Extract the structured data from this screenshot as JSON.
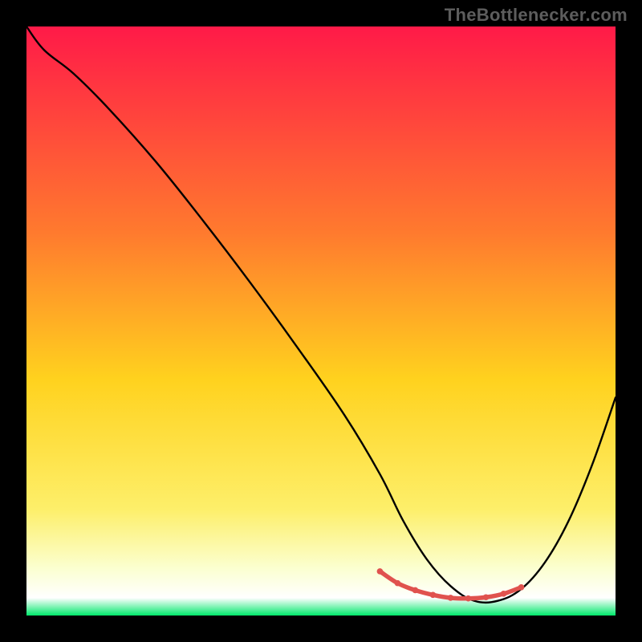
{
  "watermark": "TheBottlenecker.com",
  "chart_data": {
    "type": "line",
    "title": "",
    "xlabel": "",
    "ylabel": "",
    "xlim": [
      0,
      100
    ],
    "ylim": [
      0,
      100
    ],
    "gradient_stops": [
      {
        "offset": 0,
        "color": "#ff1a48"
      },
      {
        "offset": 0.35,
        "color": "#ff7a2e"
      },
      {
        "offset": 0.6,
        "color": "#ffd21e"
      },
      {
        "offset": 0.82,
        "color": "#fdef6a"
      },
      {
        "offset": 0.92,
        "color": "#fbffd0"
      },
      {
        "offset": 0.97,
        "color": "#ffffff"
      },
      {
        "offset": 1.0,
        "color": "#00e86b"
      }
    ],
    "curve": {
      "x": [
        0,
        3,
        8,
        14,
        22,
        30,
        38,
        46,
        54,
        60,
        64,
        68,
        72,
        76,
        80,
        84,
        88,
        92,
        96,
        100
      ],
      "y": [
        100,
        96,
        92,
        86,
        77,
        67,
        56.5,
        45.5,
        34,
        24,
        16,
        9.5,
        5,
        2.5,
        2.5,
        4.5,
        9,
        16,
        25.5,
        37
      ]
    },
    "red_band": {
      "x": [
        60,
        63,
        66,
        69,
        72,
        75,
        78,
        81,
        84
      ],
      "y": [
        7.5,
        5.5,
        4.3,
        3.5,
        3.0,
        2.9,
        3.1,
        3.7,
        4.8
      ]
    },
    "red_dot_radius": 3.8,
    "colors": {
      "curve": "#000000",
      "red": "#e0524e"
    }
  }
}
